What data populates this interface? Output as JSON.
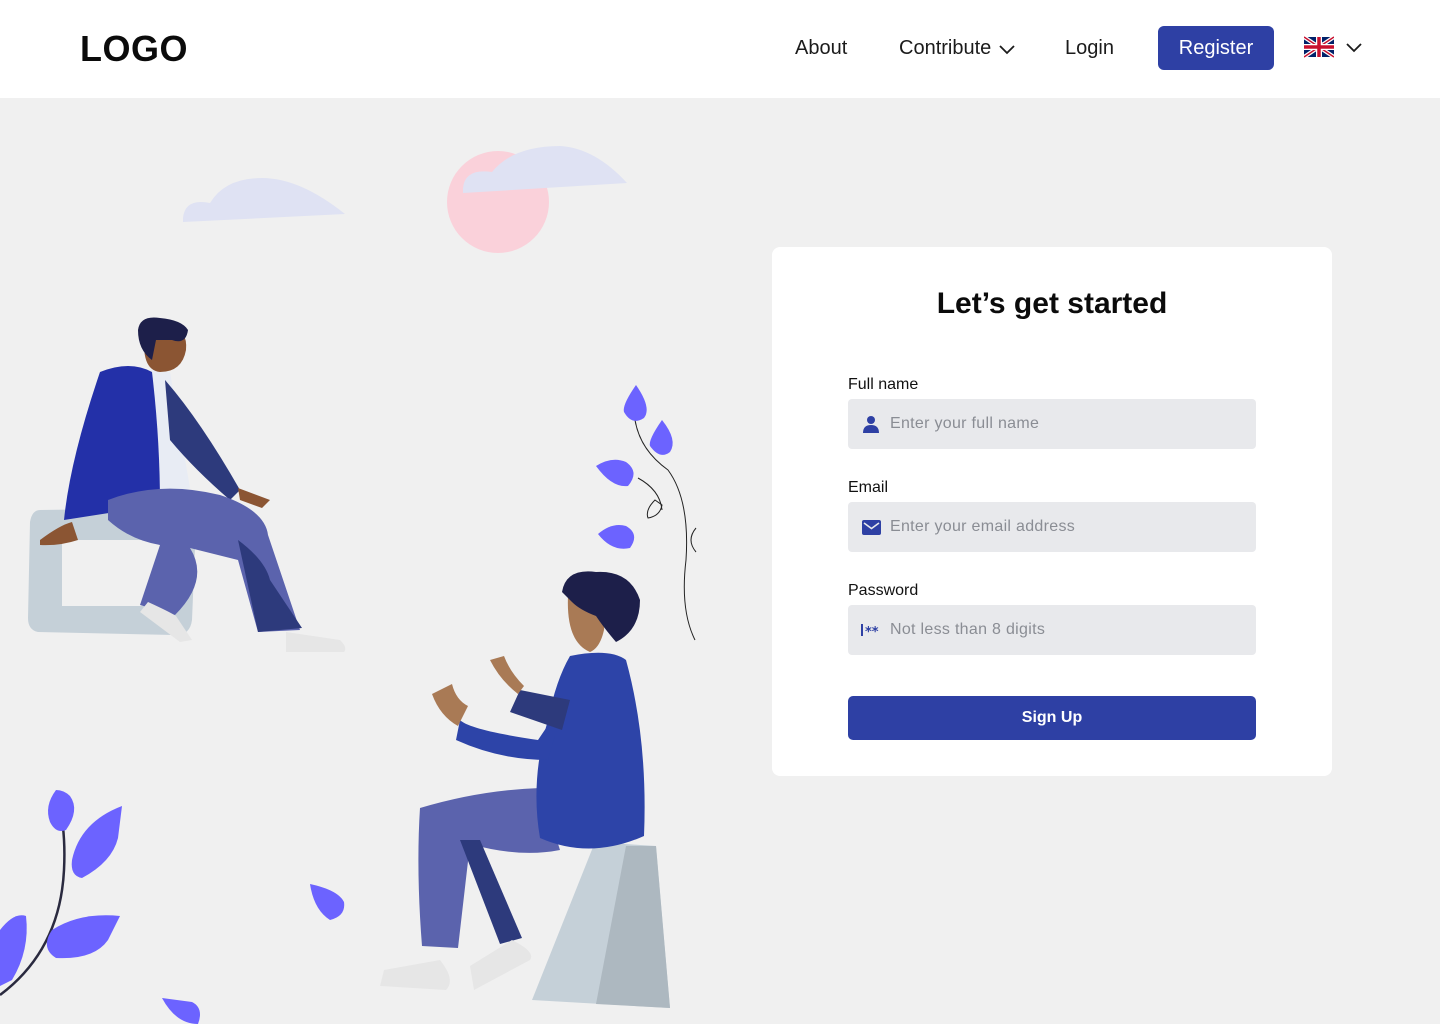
{
  "header": {
    "logo": "LOGO",
    "nav": {
      "about": "About",
      "contribute": "Contribute",
      "login": "Login",
      "register": "Register"
    },
    "language_icon": "uk-flag-icon"
  },
  "form": {
    "title": "Let’s get started",
    "full_name": {
      "label": "Full name",
      "placeholder": "Enter your full name",
      "icon": "user-icon"
    },
    "email": {
      "label": "Email",
      "placeholder": "Enter your email address",
      "icon": "mail-icon"
    },
    "password": {
      "label": "Password",
      "placeholder": "Not less than 8 digits",
      "icon": "password-icon"
    },
    "submit": "Sign Up"
  },
  "colors": {
    "accent": "#2e40a4",
    "background": "#f0f0f0",
    "field": "#e8e9ec",
    "leaf": "#6c63ff"
  }
}
